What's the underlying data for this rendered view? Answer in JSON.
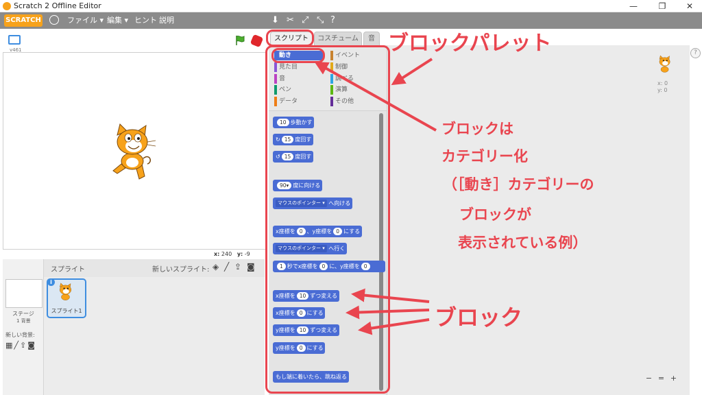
{
  "window": {
    "title": "Scratch 2 Offline Editor",
    "min": "—",
    "restore": "❐",
    "close": "✕"
  },
  "menubar": {
    "logo": "SCRATCH",
    "items": [
      "ファイル ▾",
      "編集 ▾",
      "ヒント",
      "説明"
    ]
  },
  "stage": {
    "version": "v461",
    "x_label": "x:",
    "x_value": "240",
    "y_label": "y:",
    "y_value": "-9"
  },
  "sprites": {
    "header": "スプライト",
    "new_sprite_label": "新しいスプライト:",
    "stage_label": "ステージ",
    "backdrops": "1 背景",
    "new_backdrop_label": "新しい背景:",
    "sprite_name": "スプライト1"
  },
  "tabs": [
    "スクリプト",
    "コスチューム",
    "音"
  ],
  "categories": [
    {
      "label": "動き",
      "color": "#4a6cd4"
    },
    {
      "label": "見た目",
      "color": "#8a55d7"
    },
    {
      "label": "音",
      "color": "#bb42c3"
    },
    {
      "label": "ペン",
      "color": "#0e9a6c"
    },
    {
      "label": "データ",
      "color": "#ee7d16"
    },
    {
      "label": "イベント",
      "color": "#c88330"
    },
    {
      "label": "制御",
      "color": "#e1a91a"
    },
    {
      "label": "調べる",
      "color": "#2ca5e2"
    },
    {
      "label": "演算",
      "color": "#5cb712"
    },
    {
      "label": "その他",
      "color": "#632d99"
    }
  ],
  "blocks": {
    "move_n": "10",
    "move_text": "歩動かす",
    "turn_r_n": "15",
    "turn_r_text": "度回す",
    "turn_l_n": "15",
    "turn_l_text": "度回す",
    "point_dir_n": "90▾",
    "point_dir_text": "度に向ける",
    "point_towards_dd": "マウスのポインター ▾",
    "point_towards_text": "へ向ける",
    "goto_xy_a": "x座標を",
    "goto_xy_x": "0",
    "goto_xy_b": "、y座標を",
    "goto_xy_y": "0",
    "goto_xy_c": "にする",
    "goto_dd": "マウスのポインター ▾",
    "goto_text": "へ行く",
    "glide_n": "1",
    "glide_a": "秒でx座標を",
    "glide_x": "0",
    "glide_b": "に、y座標を",
    "glide_y": "0",
    "change_x_a": "x座標を",
    "change_x_n": "10",
    "change_x_b": "ずつ変える",
    "set_x_a": "x座標を",
    "set_x_n": "0",
    "set_x_b": "にする",
    "change_y_a": "y座標を",
    "change_y_n": "10",
    "change_y_b": "ずつ変える",
    "set_y_a": "y座標を",
    "set_y_n": "0",
    "set_y_b": "にする",
    "bounce": "もし端に着いたら、跳ね返る"
  },
  "script_area": {
    "x_readout": "x: 0",
    "y_readout": "y: 0",
    "zoom_out": "−",
    "zoom_reset": "=",
    "zoom_in": "+"
  },
  "annotations": {
    "palette_title": "ブロックパレット",
    "cat_line1": "ブロックは",
    "cat_line2": "カテゴリー化",
    "cat_line3": "（［動き］カテゴリーの",
    "cat_line4": "ブロックが",
    "cat_line5": "表示されている例）",
    "block_label": "ブロック",
    "accent": "#e9454f"
  }
}
